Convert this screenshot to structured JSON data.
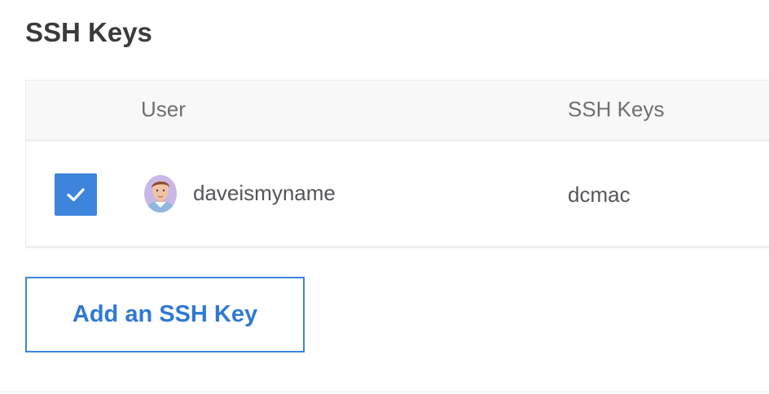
{
  "section": {
    "title": "SSH Keys"
  },
  "table": {
    "columns": {
      "user": "User",
      "ssh_keys": "SSH Keys"
    },
    "rows": [
      {
        "selected": true,
        "avatar": "user-avatar",
        "username": "daveismyname",
        "key": "dcmac"
      }
    ]
  },
  "actions": {
    "add_label": "Add an SSH Key"
  },
  "colors": {
    "accent": "#3d84dc",
    "title": "#3b3b3d",
    "header_bg": "#f8f8f8",
    "text": "#55555a"
  },
  "icons": {
    "checkbox": "check-icon"
  }
}
